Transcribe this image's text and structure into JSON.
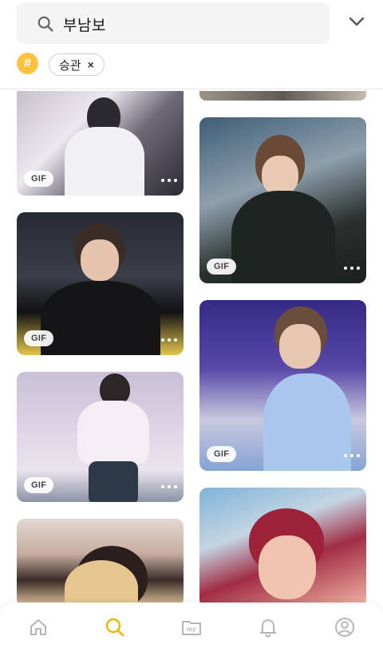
{
  "search": {
    "query": "부남보"
  },
  "filter": {
    "hash_symbol": "#",
    "tag_label": "승관",
    "tag_remove": "×"
  },
  "results": [
    {
      "badge": "GIF"
    },
    {
      "badge": "GIF"
    },
    {
      "badge": "GIF"
    },
    {
      "badge": "GIF"
    },
    {
      "badge": "GIF"
    }
  ],
  "icons": {
    "search": "search-icon",
    "expand": "chevron-down-icon",
    "home": "home-icon",
    "explore": "search-icon",
    "my": "folder-my-icon",
    "notifications": "bell-icon",
    "profile": "user-icon"
  },
  "nav": {
    "my_label": "my"
  },
  "colors": {
    "accent": "#ffc23d",
    "active_nav": "#f5b400",
    "inactive_nav": "#b5b5b5"
  }
}
